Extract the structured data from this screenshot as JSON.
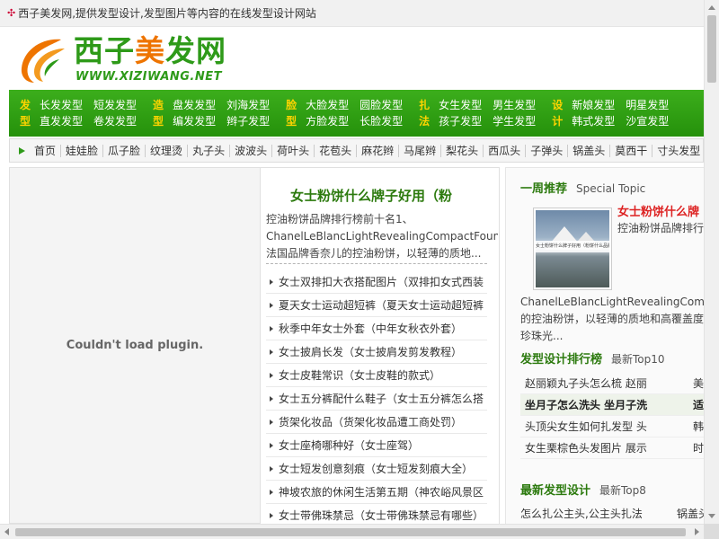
{
  "topbar": {
    "icon": "star-icon",
    "text": "西子美发网,提供发型设计,发型图片等内容的在线发型设计网站"
  },
  "logo": {
    "cn_a": "西子",
    "cn_b": "美",
    "cn_c": "发网",
    "en": "WWW.XIZIWANG.NET"
  },
  "green_nav": [
    {
      "label": [
        "发",
        "型"
      ],
      "links": [
        "长发发型",
        "短发发型",
        "直发发型",
        "卷发发型"
      ]
    },
    {
      "label": [
        "造",
        "型"
      ],
      "links": [
        "盘发发型",
        "刘海发型",
        "编发发型",
        "辫子发型"
      ]
    },
    {
      "label": [
        "脸",
        "型"
      ],
      "links": [
        "大脸发型",
        "圆脸发型",
        "方脸发型",
        "长脸发型"
      ]
    },
    {
      "label": [
        "扎",
        "法"
      ],
      "links": [
        "女生发型",
        "男生发型",
        "孩子发型",
        "学生发型"
      ]
    },
    {
      "label": [
        "设",
        "计"
      ],
      "links": [
        "新娘发型",
        "明星发型",
        "韩式发型",
        "沙宣发型"
      ]
    }
  ],
  "sub_nav": [
    "首页",
    "娃娃脸",
    "瓜子脸",
    "纹理烫",
    "丸子头",
    "波波头",
    "荷叶头",
    "花苞头",
    "麻花辫",
    "马尾辫",
    "梨花头",
    "西瓜头",
    "子弹头",
    "锅盖头",
    "莫西干",
    "寸头发型"
  ],
  "plugin": {
    "message": "Couldn't load plugin."
  },
  "center": {
    "headline": "女士粉饼什么牌子好用（粉",
    "summary": [
      "控油粉饼品牌排行榜前十名1、",
      "ChanelLeBlancLightRevealingCompactFoundation-",
      "法国品牌香奈儿的控油粉饼，以轻薄的质地..."
    ],
    "news": [
      "女士双排扣大衣搭配图片（双排扣女式西装",
      "夏天女士运动超短裤（夏天女士运动超短裤",
      "秋季中年女士外套（中年女秋衣外套）",
      "女士披肩长发（女士披肩发剪发教程）",
      "女士皮鞋常识（女士皮鞋的款式）",
      "女士五分裤配什么鞋子（女士五分裤怎么搭",
      "货架化妆品（货架化妆品遭工商处罚）",
      "女士座椅哪种好（女士座驾）",
      "女士短发创意刻痕（女士短发刻痕大全）",
      "神坡农旅的休闲生活第五期（神农峪风景区",
      "女士带佛珠禁忌（女士带佛珠禁忌有哪些）"
    ]
  },
  "right": {
    "weekly": {
      "title": "一周推荐",
      "subtitle": "Special Topic"
    },
    "thumb_caption": "女士粉饼什么牌子好用（粉饼什么品牌好用）",
    "top_title": "女士粉饼什么牌",
    "top_sub": "控油粉饼品牌排行",
    "desc": [
      "ChanelLeBlancLightRevealingCompactF",
      "的控油粉饼，以轻薄的质地和高覆盖度",
      "珍珠光..."
    ],
    "rank": {
      "title": "发型设计排行榜",
      "subtitle": "最新Top10"
    },
    "rank_rows": [
      {
        "a": "赵丽颖丸子头怎么梳 赵丽",
        "b": "美"
      },
      {
        "a": "坐月子怎么洗头 坐月子洗",
        "b": "适"
      },
      {
        "a": "头顶尖女生如何扎发型 头",
        "b": "韩"
      },
      {
        "a": "女生栗棕色头发图片 展示",
        "b": "时"
      }
    ],
    "latest": {
      "title": "最新发型设计",
      "subtitle": "最新Top8"
    },
    "latest_row": {
      "a": "怎么扎公主头,公主头扎法",
      "b": "锅盖头"
    }
  }
}
